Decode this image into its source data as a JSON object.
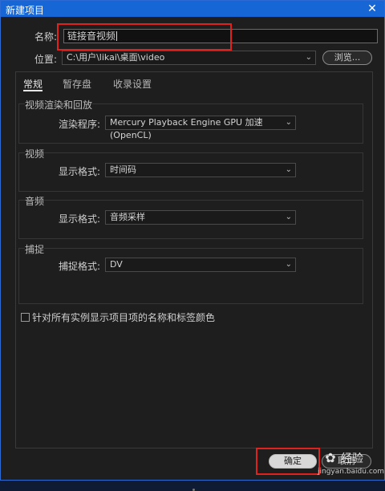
{
  "window": {
    "title": "新建项目",
    "close_glyph": "✕"
  },
  "name": {
    "label": "名称:",
    "value": "链接音视频"
  },
  "location": {
    "label": "位置:",
    "value": "C:\\用户\\likai\\桌面\\video",
    "browse_label": "浏览..."
  },
  "tabs": [
    {
      "label": "常规",
      "active": true
    },
    {
      "label": "暂存盘",
      "active": false
    },
    {
      "label": "收录设置",
      "active": false
    }
  ],
  "video_render": {
    "title": "视频渲染和回放",
    "renderer_label": "渲染程序:",
    "renderer_value": "Mercury Playback Engine GPU 加速 (OpenCL)"
  },
  "video": {
    "title": "视频",
    "format_label": "显示格式:",
    "format_value": "时间码"
  },
  "audio": {
    "title": "音频",
    "format_label": "显示格式:",
    "format_value": "音频采样"
  },
  "capture": {
    "title": "捕捉",
    "format_label": "捕捉格式:",
    "format_value": "DV"
  },
  "checkbox": {
    "label": "针对所有实例显示项目项的名称和标签颜色",
    "checked": false
  },
  "buttons": {
    "ok_label": "确定",
    "cancel_label": "取消"
  },
  "watermark": {
    "text": "经验",
    "subtext": "jingyan.baidu.com",
    "icon": "baidu-paw-icon"
  },
  "colors": {
    "titlebar": "#1666d6",
    "highlight": "#e0221f"
  }
}
